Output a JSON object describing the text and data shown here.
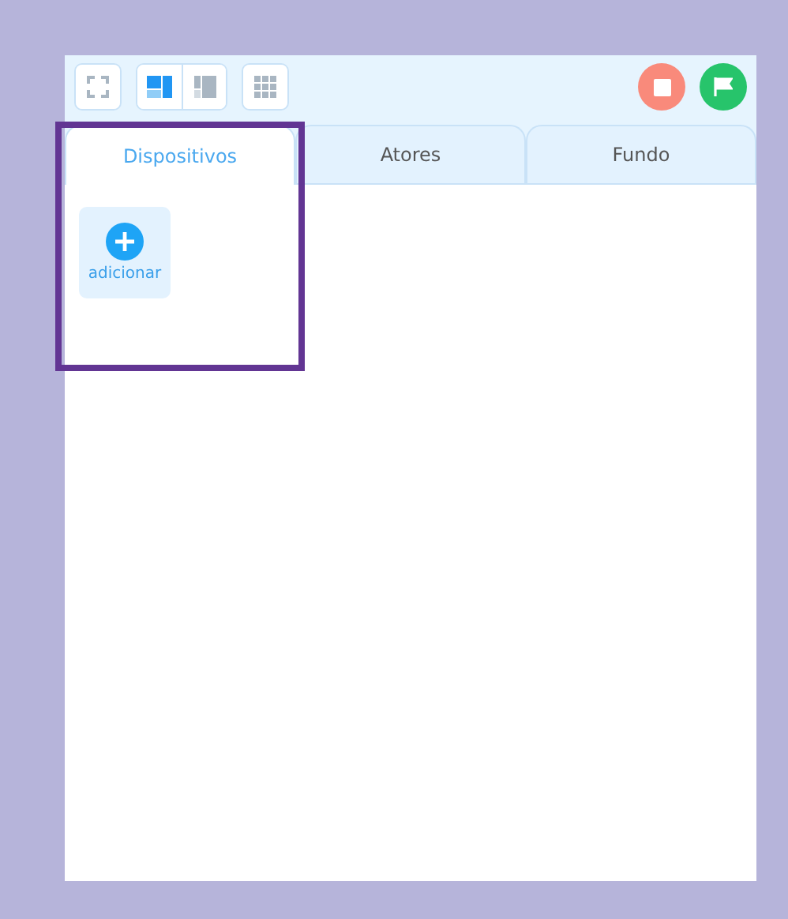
{
  "toolbar": {
    "layout_buttons": [
      {
        "kind": "fullscreen",
        "selected": false
      },
      {
        "kind": "large",
        "selected": true
      },
      {
        "kind": "small",
        "selected": false
      },
      {
        "kind": "grid",
        "selected": false
      }
    ]
  },
  "tabs": [
    {
      "label": "Dispositivos",
      "selected": true
    },
    {
      "label": "Atores",
      "selected": false
    },
    {
      "label": "Fundo",
      "selected": false
    }
  ],
  "devices": [
    {
      "label": "adicionar",
      "kind": "add"
    }
  ],
  "highlight_frame": true
}
